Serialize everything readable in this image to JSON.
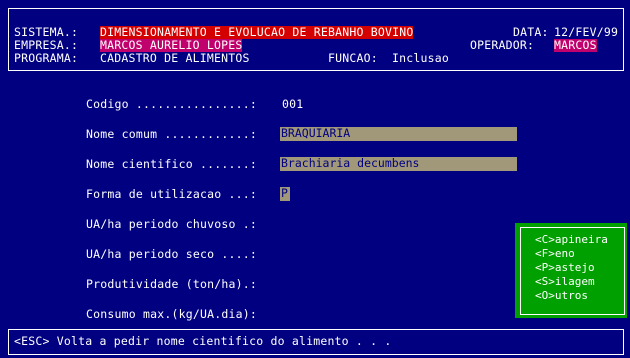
{
  "header": {
    "sistema_label": "SISTEMA.: ",
    "sistema_value": "DIMENSIONAMENTO E EVOLUCAO DE REBANHO BOVINO",
    "empresa_label": "EMPRESA.: ",
    "empresa_value": "MARCOS AURELIO LOPES",
    "programa_label": "PROGRAMA: ",
    "programa_value": "CADASTRO DE ALIMENTOS",
    "funcao_label": "FUNCAO: ",
    "funcao_value": "Inclusao",
    "data_label": "DATA: ",
    "data_value": "12/FEV/99",
    "operador_label": "OPERADOR: ",
    "operador_value": "MARCOS"
  },
  "form": {
    "codigo_label": "Codigo ................: ",
    "codigo_value": "001",
    "nome_comum_label": "Nome comum ............: ",
    "nome_comum_value": "BRAQUIARIA",
    "nome_cientifico_label": "Nome cientifico .......: ",
    "nome_cientifico_value": "Brachiaria decumbens",
    "forma_label": "Forma de utilizacao ...: ",
    "forma_value": "P",
    "ua_chuvoso_label": "UA/ha periodo chuvoso .:",
    "ua_seco_label": "UA/ha periodo seco ....:",
    "produtividade_label": "Produtividade (ton/ha).:",
    "consumo_label": "Consumo max.(kg/UA.dia):"
  },
  "menu": {
    "items": [
      "<C>apineira",
      "<F>eno",
      "<P>astejo",
      "<S>ilagem",
      "<O>utros"
    ]
  },
  "status": {
    "message": "<ESC> Volta a pedir nome cientifico do alimento . . ."
  },
  "colors": {
    "background": "#000080",
    "highlight_red": "#d40000",
    "highlight_magenta": "#c0006c",
    "field_bg": "#a09878",
    "menu_green": "#00a000"
  }
}
